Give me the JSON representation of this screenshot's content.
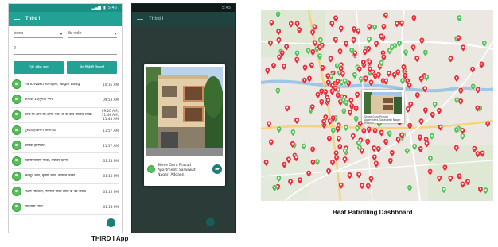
{
  "app1": {
    "status_time": "5:45",
    "title": "Third I",
    "filter_left": "अडगाव",
    "filter_right": "बीट मार्शल",
    "search_value": "2",
    "qr_button": "QR स्कॅन करा",
    "visit_button": "भेट दिलेली ठिकाणे",
    "items": [
      {
        "name": "Panchvakti Temple, Nilgiri Baug",
        "time": "10:16 AM"
      },
      {
        "name": "क्रमांक 1 हनुमान नगर",
        "time": "09:53 AM"
      },
      {
        "name": "आय.सी.आय.सी.आय. बँक, के के वाघ कॉलेज शाखा",
        "time": "09:20 AM, 11:44 AM, 11:44 AM"
      },
      {
        "name": "गुरुदेव हाउसिंग सोसायटी",
        "time": "11:57 AM"
      },
      {
        "name": "अंबिके हॉस्पिटल",
        "time": "11:57 AM"
      },
      {
        "name": "स्वामीनारायण मंदिर, तपोवन कॉर्नर",
        "time": "01:13 PM"
      },
      {
        "name": "अवधूत नगर, कृष्णा नगर, तपोवन कॉर्नर",
        "time": "01:13 PM"
      },
      {
        "name": "लक्ष्मी मेडिकल, गणपती मंदिर लाख के बर्ड जवळ",
        "time": "01:12 PM"
      },
      {
        "name": "साईबाबा मंदिर",
        "time": "01:18 PM"
      }
    ],
    "fab": "+"
  },
  "app2": {
    "status_time": "5:45",
    "title": "Third I",
    "popup_address": "Shree Guru Prasad Apartment, Saraswati Nagar, Adgaon"
  },
  "caption_app": "THIRD I App",
  "caption_dashboard": "Beat Patrolling Dashboard",
  "map_popup_caption": "Shree Guru Prasad Apartment, Saraswati Nagar, Adgaon",
  "colors": {
    "teal": "#22a195",
    "pin_red": "#e6303a",
    "pin_green": "#57c05a"
  }
}
